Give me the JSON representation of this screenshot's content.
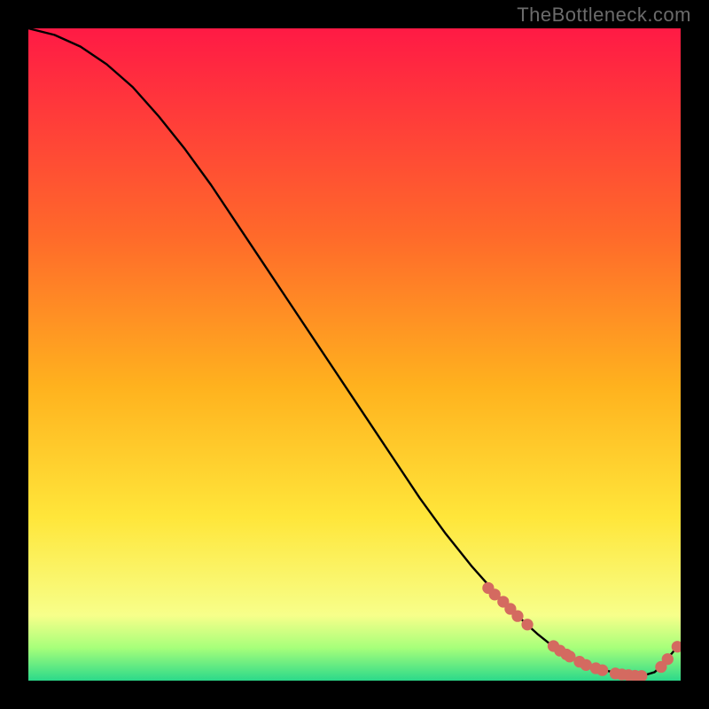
{
  "watermark": "TheBottleneck.com",
  "colors": {
    "gradient_top": "#ff1a45",
    "gradient_mid1": "#ff6a2a",
    "gradient_mid2": "#ffb21e",
    "gradient_mid3": "#ffe63a",
    "gradient_low": "#f7ff8a",
    "gradient_green1": "#a6ff7a",
    "gradient_green2": "#2bd98a",
    "curve": "#000000",
    "marker": "#d46a60"
  },
  "chart_data": {
    "type": "line",
    "title": "",
    "xlabel": "",
    "ylabel": "",
    "xlim": [
      0,
      100
    ],
    "ylim": [
      0,
      100
    ],
    "curve": {
      "x": [
        0,
        4,
        8,
        12,
        16,
        20,
        24,
        28,
        32,
        36,
        40,
        44,
        48,
        52,
        56,
        60,
        64,
        68,
        72,
        76,
        78,
        80,
        82,
        84,
        86,
        88,
        90,
        92,
        94,
        96,
        97,
        98,
        99.5
      ],
      "y": [
        100,
        99,
        97.2,
        94.5,
        91,
        86.5,
        81.5,
        76,
        70,
        64,
        58,
        52,
        46,
        40,
        34,
        28,
        22.5,
        17.5,
        13,
        9,
        7.2,
        5.6,
        4.3,
        3.2,
        2.4,
        1.7,
        1.2,
        0.9,
        0.7,
        1.3,
        2.2,
        3.4,
        5.2
      ]
    },
    "markers": [
      {
        "x": 70.5,
        "y": 14.2
      },
      {
        "x": 71.5,
        "y": 13.2
      },
      {
        "x": 72.8,
        "y": 12.1
      },
      {
        "x": 73.9,
        "y": 11.0
      },
      {
        "x": 75.0,
        "y": 9.9
      },
      {
        "x": 76.5,
        "y": 8.6
      },
      {
        "x": 80.5,
        "y": 5.3
      },
      {
        "x": 81.5,
        "y": 4.6
      },
      {
        "x": 82.5,
        "y": 4.0
      },
      {
        "x": 83.0,
        "y": 3.7
      },
      {
        "x": 84.5,
        "y": 2.9
      },
      {
        "x": 85.5,
        "y": 2.4
      },
      {
        "x": 87.0,
        "y": 1.9
      },
      {
        "x": 88.0,
        "y": 1.6
      },
      {
        "x": 90.0,
        "y": 1.1
      },
      {
        "x": 91.0,
        "y": 0.95
      },
      {
        "x": 92.0,
        "y": 0.85
      },
      {
        "x": 93.0,
        "y": 0.75
      },
      {
        "x": 94.0,
        "y": 0.72
      },
      {
        "x": 97.0,
        "y": 2.1
      },
      {
        "x": 98.0,
        "y": 3.3
      },
      {
        "x": 99.5,
        "y": 5.2
      }
    ]
  }
}
